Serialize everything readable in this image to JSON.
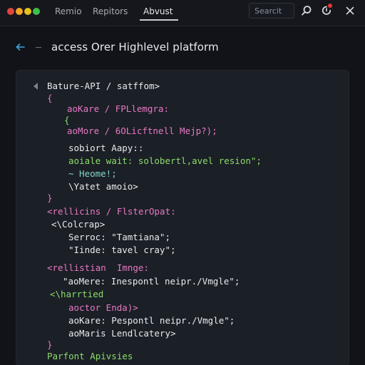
{
  "window": {
    "traffic_lights": [
      "#e2453c",
      "#f5a623",
      "#e8c21a",
      "#3ec14b"
    ]
  },
  "tabs": [
    {
      "label": "Remio"
    },
    {
      "label": "Repitors"
    },
    {
      "label": "Abvust"
    }
  ],
  "search": {
    "placeholder": "Searcit"
  },
  "header": {
    "back_icon": "arrow-left-icon",
    "title": "access Orer Highlevel platform"
  },
  "code": {
    "colors": {
      "pink": "#e879c6",
      "green": "#8bdc6a",
      "white": "#e8eaee",
      "teal": "#7fd6c8"
    },
    "lines": [
      {
        "text": "Bature-API / satffom>",
        "color": "white"
      },
      {
        "text": "{",
        "color": "pink"
      },
      {
        "text": "aoKare / FPLlemgra:",
        "color": "pink"
      },
      {
        "text": "{",
        "color": "green"
      },
      {
        "text": "aoMore / 6OLicftnell Mejp?);",
        "color": "pink"
      },
      {
        "text": "sobiort Aapy::",
        "color": "white"
      },
      {
        "text": "aoiale wait: solobertl,avel resion\";",
        "color": "green"
      },
      {
        "text": "~ Heome!;",
        "color": "teal"
      },
      {
        "text": "\\Yatet amoio>",
        "color": "white"
      },
      {
        "text": "}",
        "color": "pink"
      },
      {
        "text": "<rellicins / FlsterOpat:",
        "color": "pink"
      },
      {
        "text": "<\\Colcrap>",
        "color": "white"
      },
      {
        "text": "Serroc: \"Tamtiana\";",
        "color": "white"
      },
      {
        "text": "\"Iinde: tavel cray\";",
        "color": "white"
      },
      {
        "text": "<rellistian  Imnge:",
        "color": "pink"
      },
      {
        "text": "\"aoMere: Inespontl neipr./Vmgle\";",
        "color": "white"
      },
      {
        "text": "<\\harrtied",
        "color": "green"
      },
      {
        "text": "aoctor Enda)>",
        "color": "pink"
      },
      {
        "text": "aoKare: Pespontl neipr./Vmgle\";",
        "color": "white"
      },
      {
        "text": "aoMaris Lendlcatery>",
        "color": "white"
      },
      {
        "text": "}",
        "color": "pink"
      },
      {
        "text": "Parfont Apivsies",
        "color": "green"
      }
    ]
  }
}
